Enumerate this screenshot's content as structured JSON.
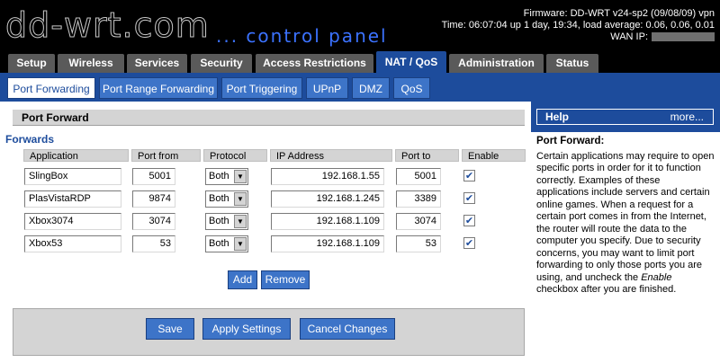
{
  "header": {
    "logo": "dd-wrt.com",
    "tagline": "... control panel",
    "firmware_line": "Firmware: DD-WRT v24-sp2 (09/08/09) vpn",
    "time_line": "Time: 06:07:04 up 1 day, 19:34, load average: 0.06, 0.06, 0.01",
    "wan_label": "WAN IP:"
  },
  "main_tabs": [
    {
      "label": "Setup"
    },
    {
      "label": "Wireless"
    },
    {
      "label": "Services"
    },
    {
      "label": "Security"
    },
    {
      "label": "Access Restrictions"
    },
    {
      "label": "NAT / QoS"
    },
    {
      "label": "Administration"
    },
    {
      "label": "Status"
    }
  ],
  "sub_tabs": [
    {
      "label": "Port Forwarding"
    },
    {
      "label": "Port Range Forwarding"
    },
    {
      "label": "Port Triggering"
    },
    {
      "label": "UPnP"
    },
    {
      "label": "DMZ"
    },
    {
      "label": "QoS"
    }
  ],
  "section": {
    "title": "Port Forward",
    "group_label": "Forwards"
  },
  "columns": {
    "application": "Application",
    "port_from": "Port from",
    "protocol": "Protocol",
    "ip_address": "IP Address",
    "port_to": "Port to",
    "enable": "Enable"
  },
  "rows": [
    {
      "application": "SlingBox",
      "port_from": "5001",
      "protocol": "Both",
      "ip": "192.168.1.55",
      "port_to": "5001",
      "enabled": "✔"
    },
    {
      "application": "PlasVistaRDP",
      "port_from": "9874",
      "protocol": "Both",
      "ip": "192.168.1.245",
      "port_to": "3389",
      "enabled": "✔"
    },
    {
      "application": "Xbox3074",
      "port_from": "3074",
      "protocol": "Both",
      "ip": "192.168.1.109",
      "port_to": "3074",
      "enabled": "✔"
    },
    {
      "application": "Xbox53",
      "port_from": "53",
      "protocol": "Both",
      "ip": "192.168.1.109",
      "port_to": "53",
      "enabled": "✔"
    }
  ],
  "row_buttons": {
    "add": "Add",
    "remove": "Remove"
  },
  "footer_buttons": {
    "save": "Save",
    "apply": "Apply Settings",
    "cancel": "Cancel Changes"
  },
  "help": {
    "title": "Help",
    "more": "more...",
    "heading": "Port Forward:",
    "body_1": "Certain applications may require to open specific ports in order for it to function correctly. Examples of these applications include servers and certain online games. When a request for a certain port comes in from the Internet, the router will route the data to the computer you specify. Due to security concerns, you may want to limit port forwarding to only those ports you are using, and uncheck the ",
    "body_em": "Enable",
    "body_2": " checkbox after you are finished."
  },
  "colors": {
    "accent_blue": "#1d4c9c",
    "button_blue": "#3d74c8",
    "tab_grey": "#5a5a5a",
    "panel_grey": "#d4d4d4",
    "tagline_blue": "#3b72ff"
  }
}
